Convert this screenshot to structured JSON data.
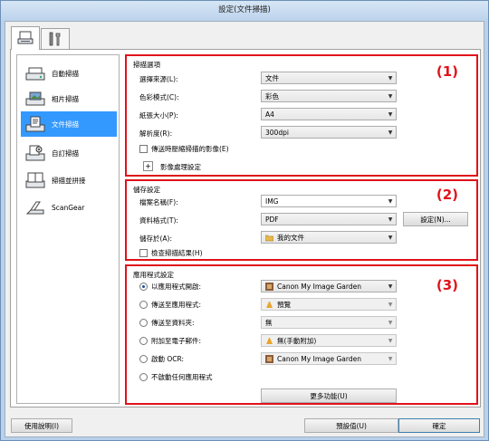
{
  "window": {
    "title": "設定(文件掃描)"
  },
  "tabs": [
    {
      "icon": "scan-settings-icon"
    },
    {
      "icon": "general-settings-icon"
    }
  ],
  "sidebar": {
    "items": [
      {
        "label": "自動掃描",
        "icon": "auto-scan-icon"
      },
      {
        "label": "相片掃描",
        "icon": "photo-scan-icon"
      },
      {
        "label": "文件掃描",
        "icon": "document-scan-icon",
        "selected": true
      },
      {
        "label": "自訂掃描",
        "icon": "custom-scan-icon"
      },
      {
        "label": "掃描並拼接",
        "icon": "scan-stitch-icon"
      },
      {
        "label": "ScanGear",
        "icon": "scangear-icon"
      }
    ]
  },
  "scan_options": {
    "title": "掃描選項",
    "number": "(1)",
    "rows": [
      {
        "label": "選擇來源(L):",
        "value": "文件"
      },
      {
        "label": "色彩模式(C):",
        "value": "彩色"
      },
      {
        "label": "紙張大小(P):",
        "value": "A4"
      },
      {
        "label": "解析度(R):",
        "value": "300dpi"
      }
    ],
    "checkbox_label": "傳送時壓縮掃描的影像(E)",
    "image_processing_label": "影像處理設定"
  },
  "save_settings": {
    "title": "儲存設定",
    "number": "(2)",
    "file_name_label": "檔案名稱(F):",
    "file_name_value": "IMG",
    "data_format_label": "資料格式(T):",
    "data_format_value": "PDF",
    "settings_button": "設定(N)...",
    "save_in_label": "儲存於(A):",
    "save_in_value": "我的文件",
    "check_results_label": "檢查掃描結果(H)"
  },
  "app_settings": {
    "title": "應用程式設定",
    "number": "(3)",
    "rows": [
      {
        "label": "以應用程式開啟:",
        "value": "Canon My Image Garden",
        "selected": true,
        "enabled": true
      },
      {
        "label": "傳送至應用程式:",
        "value": "預覽",
        "selected": false,
        "enabled": false
      },
      {
        "label": "傳送至資料夾:",
        "value": "無",
        "selected": false,
        "enabled": false
      },
      {
        "label": "附加至電子郵件:",
        "value": "無(手動附加)",
        "selected": false,
        "enabled": false
      },
      {
        "label": "啟動 OCR:",
        "value": "Canon My Image Garden",
        "selected": false,
        "enabled": false
      }
    ],
    "no_app_label": "不啟動任何應用程式",
    "more_button": "更多功能(U)"
  },
  "footer": {
    "help_button": "使用說明(I)",
    "defaults_button": "預設值(U)",
    "ok_button": "確定"
  }
}
